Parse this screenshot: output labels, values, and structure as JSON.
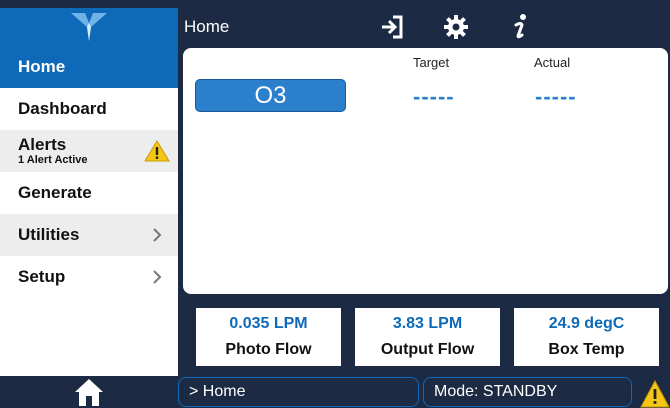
{
  "header": {
    "title": "Home",
    "icons": [
      "logout-icon",
      "gear-icon",
      "info-icon"
    ]
  },
  "sidebar": {
    "items": [
      {
        "label": "Home",
        "active": true
      },
      {
        "label": "Dashboard"
      },
      {
        "label": "Alerts",
        "sub": "1 Alert Active",
        "warning": true
      },
      {
        "label": "Generate"
      },
      {
        "label": "Utilities",
        "chevron": true
      },
      {
        "label": "Setup",
        "chevron": true
      }
    ]
  },
  "main": {
    "gas_label": "O3",
    "target_header": "Target",
    "actual_header": "Actual",
    "target_value": "-----",
    "actual_value": "-----"
  },
  "status": [
    {
      "value": "0.035 LPM",
      "label": "Photo Flow"
    },
    {
      "value": "3.83 LPM",
      "label": "Output Flow"
    },
    {
      "value": "24.9 degC",
      "label": "Box Temp"
    }
  ],
  "footer": {
    "breadcrumb": "> Home",
    "mode": "Mode: STANDBY"
  },
  "colors": {
    "nav_bg": "#1c2a44",
    "accent": "#0e6ab8",
    "value_blue": "#2b7fcb",
    "warning": "#f5c518"
  }
}
